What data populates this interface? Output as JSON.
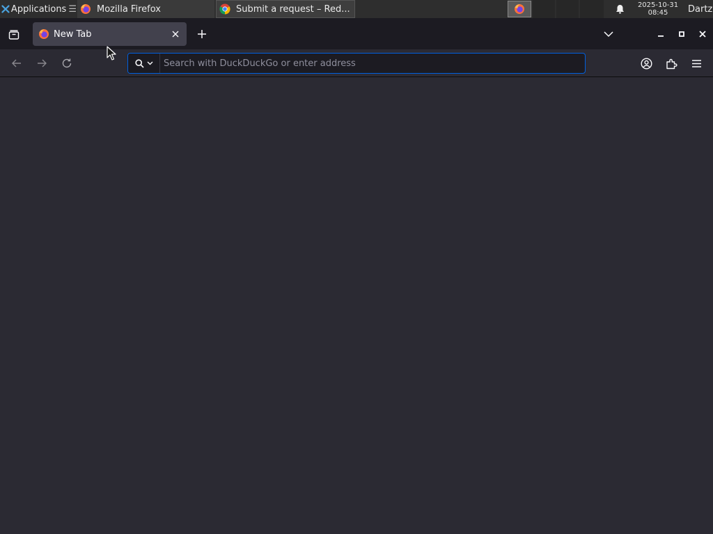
{
  "panel": {
    "applications_label": "Applications",
    "tasks": [
      {
        "label": "Mozilla Firefox",
        "icon": "firefox-icon"
      },
      {
        "label": "Submit a request – Red...",
        "icon": "chrome-icon"
      }
    ],
    "clock": {
      "date": "2025-10-31",
      "time": "08:45"
    },
    "user": "Dartz",
    "icons": [
      "applications-menu-icon",
      "bell-icon",
      "tray-firefox-icon"
    ]
  },
  "tabs": [
    {
      "label": "New Tab",
      "active": true,
      "icon": "firefox-icon"
    }
  ],
  "urlbar": {
    "placeholder": "Search with DuckDuckGo or enter address",
    "value": ""
  },
  "toolbar_icons": [
    "back-arrow-icon",
    "forward-arrow-icon",
    "reload-icon",
    "search-icon",
    "chevron-down-icon",
    "account-icon",
    "extensions-icon",
    "hamburger-menu-icon"
  ],
  "colors": {
    "panel_bg": "#2e2e2e",
    "tabstrip_bg": "#1c1b22",
    "active_tab_bg": "#42414d",
    "toolbar_bg": "#2b2a33",
    "urlbar_focus_border": "#0060df",
    "content_bg": "#2b2a33"
  }
}
